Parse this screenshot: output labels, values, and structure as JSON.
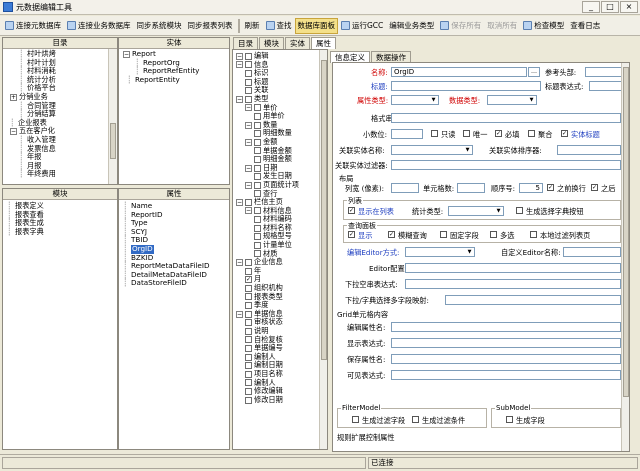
{
  "window": {
    "title": "元数据编辑工具"
  },
  "toolbar": [
    {
      "label": "连接元数据库"
    },
    {
      "label": "连接业务数据库"
    },
    {
      "label": "同步系统模块"
    },
    {
      "label": "同步报表列表"
    },
    {
      "label": "刷新"
    },
    {
      "label": "查找"
    },
    {
      "label": "数据库面板"
    },
    {
      "label": "运行GCC"
    },
    {
      "label": "编辑业务类型"
    },
    {
      "label": "保存所有"
    },
    {
      "label": "取消所有"
    },
    {
      "label": "检查模型"
    },
    {
      "label": "查看日志"
    }
  ],
  "catalog_pane": {
    "header": "目录",
    "items": [
      "村叶烘烤",
      "村叶计划",
      "村料消耗",
      "统计分析",
      "价格平台",
      "分销业务",
      "合同管理",
      "分销结算",
      "企业报表",
      "五在客户化",
      "收入管理",
      "发票信息",
      "年报",
      "月报",
      "年终费用"
    ]
  },
  "entity_pane": {
    "header": "实体",
    "items": [
      "Report",
      "ReportOrg",
      "ReportRefEntity",
      "ReportEntity"
    ]
  },
  "module_pane": {
    "header": "模块",
    "items": [
      "报表定义",
      "报表查看",
      "报表生成",
      "报表字典"
    ]
  },
  "attr_pane": {
    "header": "属性",
    "items": [
      "Name",
      "ReportID",
      "Type",
      "SCYJ",
      "TBID",
      "OrgID",
      "BZKID",
      "ReportMetaDataFileID",
      "DetailMetaDataFileID",
      "DataStoreFileID"
    ],
    "selected": "OrgID"
  },
  "mid_tabs": [
    "目录",
    "模块",
    "实体",
    "属性"
  ],
  "mid_tree": [
    "编辑",
    "信息",
    "标识",
    "标题",
    "关联",
    "类型",
    "单价",
    "用单价",
    "数量",
    "明细数量",
    "金额",
    "单据金额",
    "明细金额",
    "日期",
    "发生日期",
    "页面统计项",
    "查行",
    "栏信主页",
    "材料信息",
    "材料编码",
    "材料名称",
    "规格型号",
    "计量单位",
    "材质",
    "企业信息",
    "年",
    "月",
    "组织机构",
    "报表类型",
    "季度",
    "单据信息",
    "审核状态",
    "说明",
    "自检复核",
    "单据编号",
    "编制人",
    "编制日期",
    "项目名称",
    "编制人",
    "修改编辑",
    "修改日期"
  ],
  "right_tabs": [
    "信息定义",
    "数据操作"
  ],
  "form": {
    "name_label": "名称:",
    "name_value": "OrgID",
    "ref_label": "参考头部:",
    "title_label": "标题:",
    "title_expr_label": "标题表达式:",
    "attr_type_label": "属性类型:",
    "data_type_label": "数据类型:",
    "format_label": "格式串:",
    "decimal_label": "小数位:",
    "readonly_label": "只读",
    "unique_label": "唯一",
    "required_label": "必填",
    "aggregate_label": "聚合",
    "entity_flag_label": "实体标题",
    "rel_entity_label": "关联实体名称:",
    "rel_entity_sort_label": "关联实体排序器:",
    "rel_entity_filter_label": "关联实体过滤器:",
    "layout_group": "布局",
    "col_width_label": "列宽 (像素):",
    "cell_count_label": "单元格数:",
    "order_label": "顺序号:",
    "order_value": "5",
    "wrap_before_label": "之前换行",
    "wrap_after_label": "之后",
    "list_group": "列表",
    "show_in_list_label": "显示在列表",
    "stat_type_label": "统计类型:",
    "gen_select_label": "生成选择字典按钮",
    "query_group": "查询面板",
    "show_label": "显示",
    "fuzzy_label": "模糊查询",
    "fixed_field_label": "固定字段",
    "multi_label": "多选",
    "filter_page_label": "本地过滤列表页",
    "editor_mode_label": "编辑Editor方式:",
    "custom_editor_label": "自定义Editor名称:",
    "editor_cfg_label": "Editor配置:",
    "dropdown_expr_label": "下拉空串表达式:",
    "dropdown_dict_label": "下拉/字典选择多字段映射:",
    "grid_group": "Grid单元格内容",
    "edit_attr_label": "编辑属性名:",
    "show_expr_label": "显示表达式:",
    "save_attr_label": "保存属性名:",
    "visible_expr_label": "可见表达式:",
    "filter_model_group": "FilterModel",
    "gen_filter_field_label": "生成过滤字段",
    "gen_filter_cond_label": "生成过滤条件",
    "sub_model_group": "SubModel",
    "gen_field_label": "生成字段",
    "bottom_group": "规则扩展控制属性"
  },
  "status": {
    "text": "已连接"
  },
  "colors": {
    "selection": "#316ac5",
    "required_label": "#d00000",
    "active_tool": "#f4e08a"
  }
}
